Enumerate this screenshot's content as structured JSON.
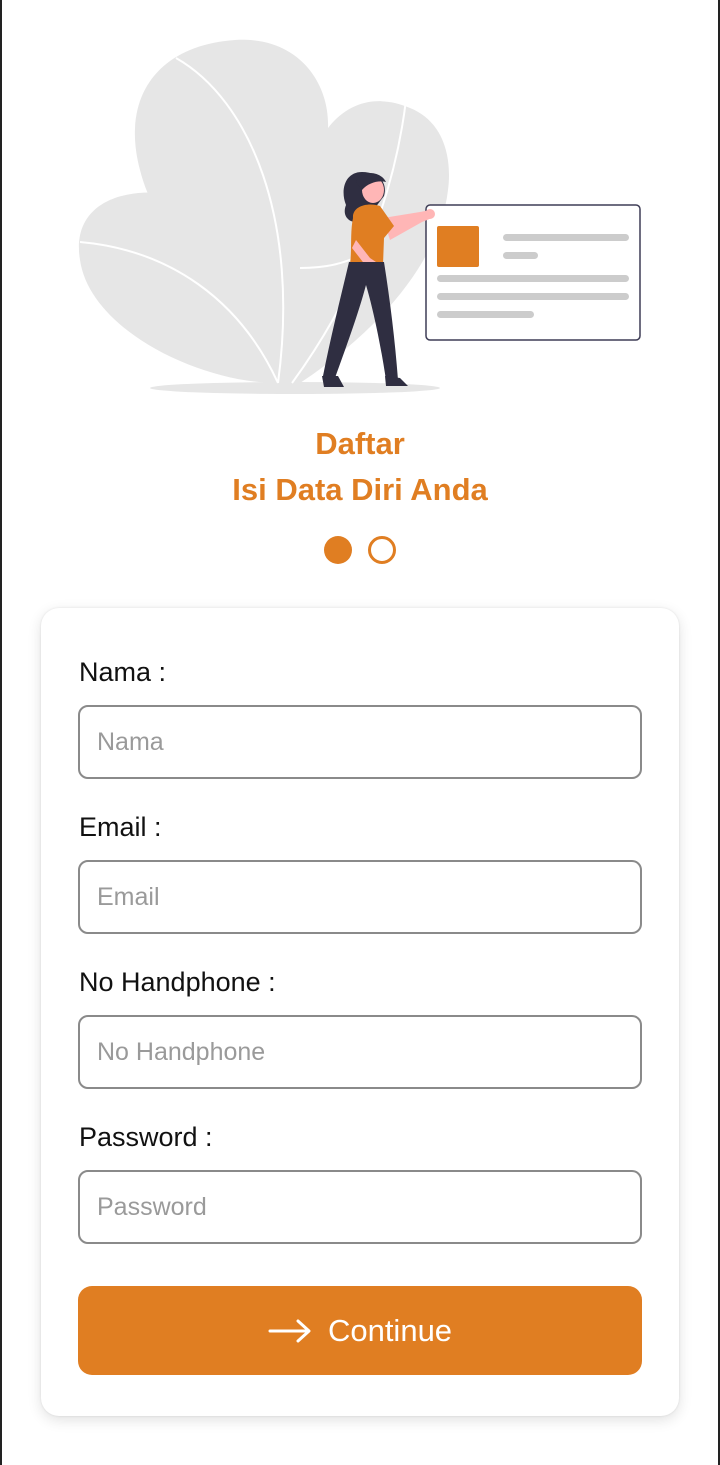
{
  "colors": {
    "accent": "#E07E22",
    "blob": "#E6E6E6",
    "figure_dark": "#2F2E41",
    "skin": "#FFB6B6"
  },
  "header": {
    "title_line1": "Daftar",
    "title_line2": "Isi Data Diri Anda"
  },
  "steps": {
    "total": 2,
    "current": 1
  },
  "form": {
    "fields": [
      {
        "label": "Nama :",
        "placeholder": "Nama"
      },
      {
        "label": "Email :",
        "placeholder": "Email"
      },
      {
        "label": "No Handphone :",
        "placeholder": "No Handphone"
      },
      {
        "label": "Password :",
        "placeholder": "Password"
      }
    ],
    "continue_label": "Continue",
    "continue_icon": "arrow-right-icon"
  }
}
